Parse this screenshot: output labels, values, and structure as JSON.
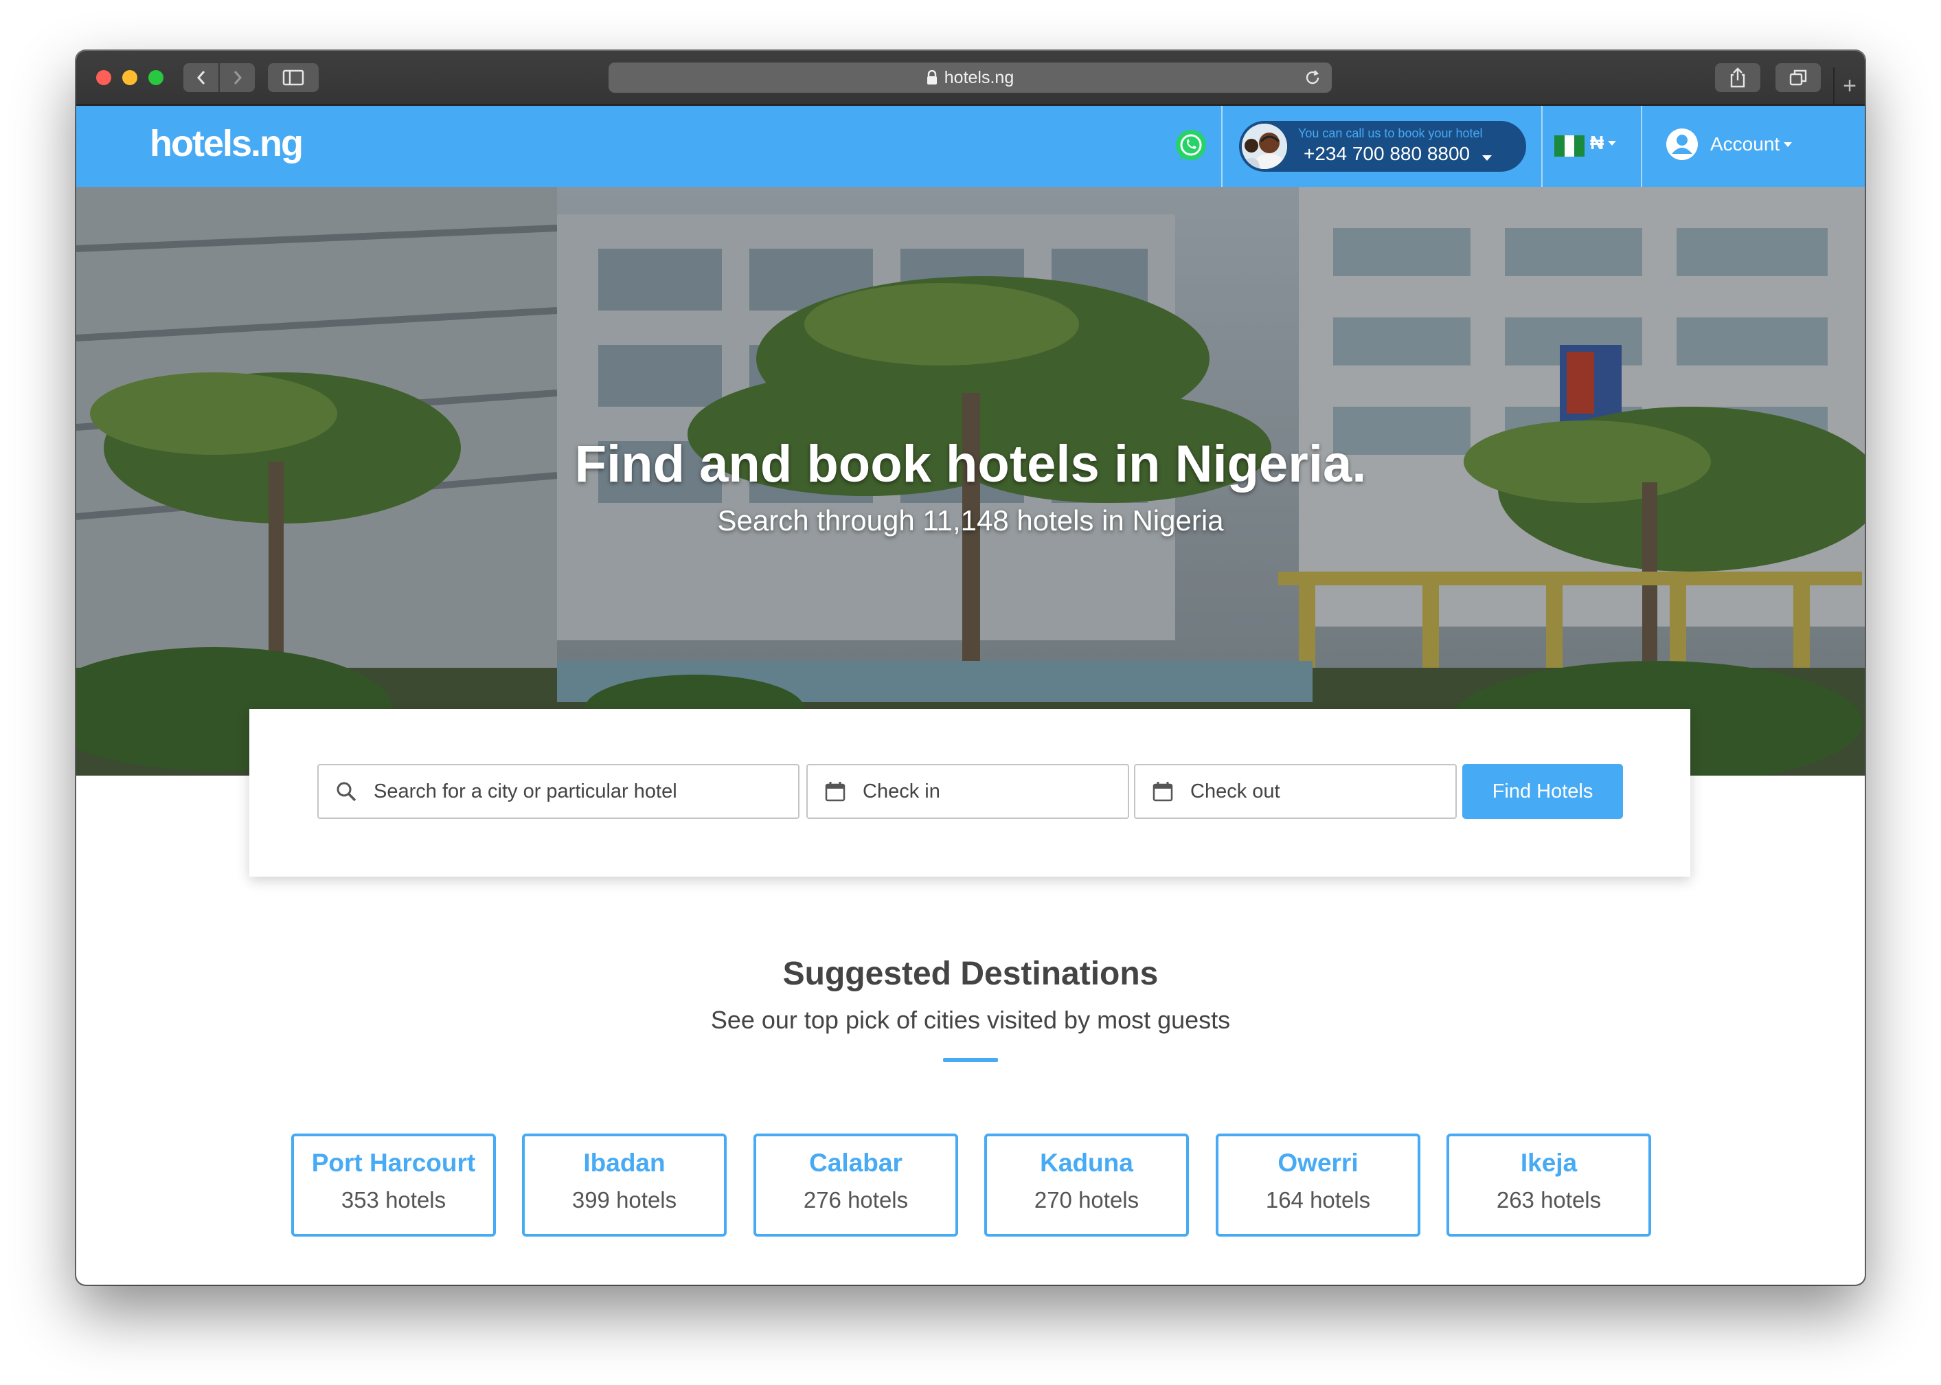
{
  "browser": {
    "url": "hotels.ng"
  },
  "header": {
    "logo": "hotels.ng",
    "call_prompt": "You can call us to book your hotel",
    "phone": "+234 700 880 8800",
    "currency": "₦",
    "account_label": "Account"
  },
  "hero": {
    "title": "Find and book hotels in Nigeria.",
    "subtitle": "Search through 11,148 hotels in Nigeria"
  },
  "search": {
    "placeholder": "Search for a city or particular hotel",
    "checkin_label": "Check in",
    "checkout_label": "Check out",
    "button_label": "Find Hotels"
  },
  "destinations": {
    "title": "Suggested Destinations",
    "subtitle": "See our top pick of cities visited by most guests",
    "items": [
      {
        "city": "Port Harcourt",
        "count": "353 hotels"
      },
      {
        "city": "Ibadan",
        "count": "399 hotels"
      },
      {
        "city": "Calabar",
        "count": "276 hotels"
      },
      {
        "city": "Kaduna",
        "count": "270 hotels"
      },
      {
        "city": "Owerri",
        "count": "164 hotels"
      },
      {
        "city": "Ikeja",
        "count": "263 hotels"
      }
    ]
  },
  "colors": {
    "brand_blue": "#46aaf5",
    "call_pill": "#194d85",
    "flag_green": "#1a8a3c"
  },
  "icons": [
    "lock-icon",
    "reload-icon",
    "whatsapp-icon",
    "account-icon",
    "search-icon",
    "calendar-icon",
    "caret-down-icon",
    "share-icon",
    "tabs-icon",
    "sidebar-icon"
  ]
}
